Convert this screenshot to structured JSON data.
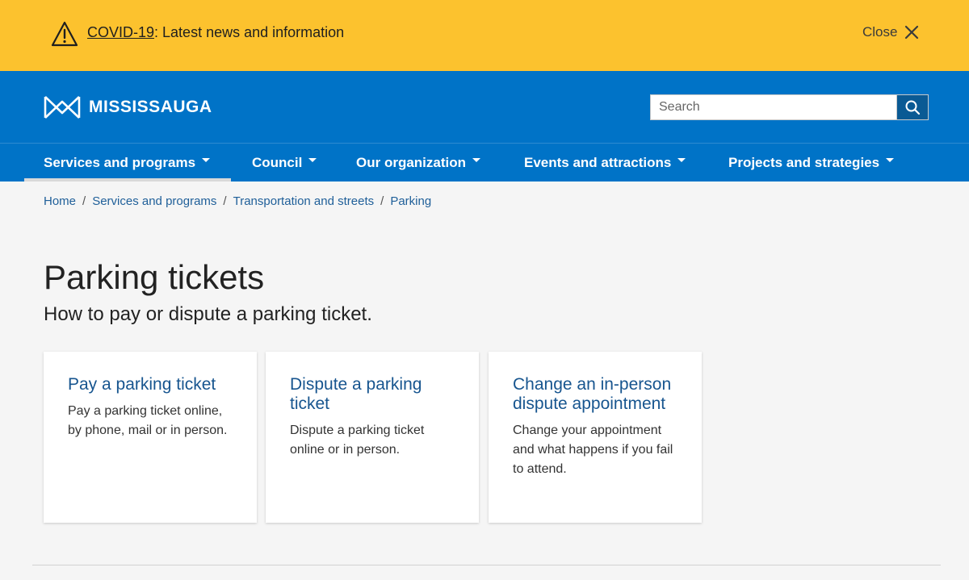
{
  "alert": {
    "link_text": "COVID-19",
    "text": ": Latest news and information",
    "close_label": "Close"
  },
  "header": {
    "logo_text": "MISSISSAUGA",
    "search": {
      "placeholder": "Search",
      "value": ""
    }
  },
  "nav": {
    "items": [
      {
        "label": "Services and programs",
        "active": true
      },
      {
        "label": "Council",
        "active": false
      },
      {
        "label": "Our organization",
        "active": false
      },
      {
        "label": "Events and attractions",
        "active": false
      },
      {
        "label": "Projects and strategies",
        "active": false
      }
    ]
  },
  "breadcrumb": {
    "items": [
      "Home",
      "Services and programs",
      "Transportation and streets",
      "Parking"
    ],
    "separator": "/"
  },
  "page": {
    "title": "Parking tickets",
    "subtitle": "How to pay or dispute a parking ticket."
  },
  "cards": [
    {
      "title": "Pay a parking ticket",
      "desc": "Pay a parking ticket online, by phone, mail or in person."
    },
    {
      "title": "Dispute a parking ticket",
      "desc": "Dispute a parking ticket online or in person."
    },
    {
      "title": "Change an in-person dispute appointment",
      "desc": "Change your appointment and what happens if you fail to attend."
    }
  ],
  "colors": {
    "alert_bg": "#fcc22e",
    "header_bg": "#0073c7",
    "link": "#1f5f99",
    "card_title": "#17558f"
  },
  "icons": {
    "alert": "warning-triangle-icon",
    "close": "close-x-icon",
    "search": "search-icon",
    "logo": "mississauga-logo-icon",
    "caret": "caret-down-icon"
  }
}
